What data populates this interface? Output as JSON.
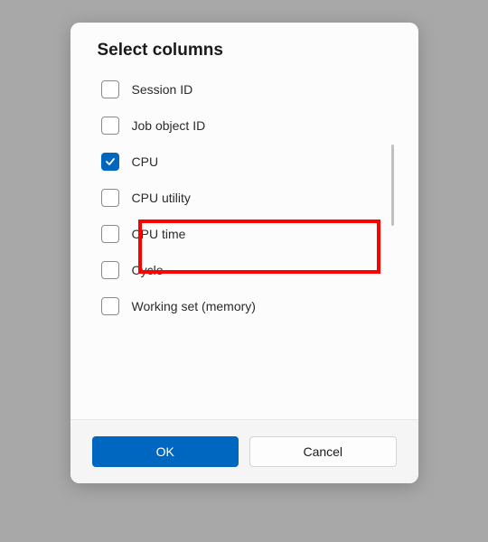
{
  "dialog": {
    "title": "Select columns",
    "options": [
      {
        "label": "Session ID",
        "checked": false
      },
      {
        "label": "Job object ID",
        "checked": false
      },
      {
        "label": "CPU",
        "checked": true
      },
      {
        "label": "CPU utility",
        "checked": false
      },
      {
        "label": "CPU time",
        "checked": false
      },
      {
        "label": "Cycle",
        "checked": false
      },
      {
        "label": "Working set (memory)",
        "checked": false
      }
    ],
    "highlighted_index": 3,
    "buttons": {
      "ok": "OK",
      "cancel": "Cancel"
    },
    "colors": {
      "accent": "#0067c0",
      "highlight_border": "#ff0000"
    }
  }
}
